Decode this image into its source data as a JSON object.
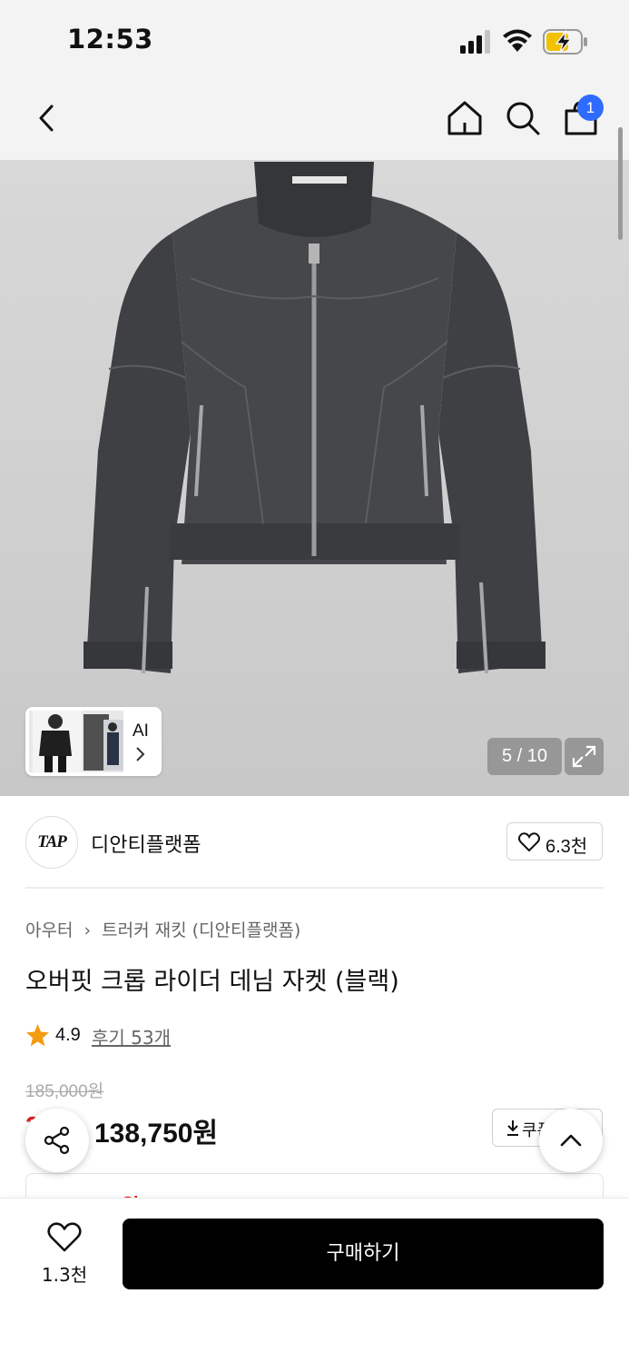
{
  "status_bar": {
    "time": "12:53"
  },
  "nav": {
    "cart_count": "1"
  },
  "gallery": {
    "ai_label": "AI",
    "page_indicator": "5 / 10"
  },
  "brand": {
    "logo_text": "TAP",
    "name": "디안티플랫폼",
    "likes": "6.3천"
  },
  "product": {
    "breadcrumb": [
      "아우터",
      "트러커 재킷 (디안티플랫폼)"
    ],
    "title": "오버핏 크롭 라이더 데님 자켓 (블랙)",
    "rating": "4.9",
    "reviews": "후기 53개",
    "original_price": "185,000원",
    "discount_rate": "25%",
    "sale_price": "138,750원",
    "coupon_label": "쿠폰받기",
    "benefit_text": "118,000원"
  },
  "bottom_bar": {
    "wish_count": "1.3천",
    "buy_label": "구매하기"
  },
  "colors": {
    "accent_red": "#e0241b",
    "badge_blue": "#2f6bff",
    "buy_button": "#000000"
  }
}
